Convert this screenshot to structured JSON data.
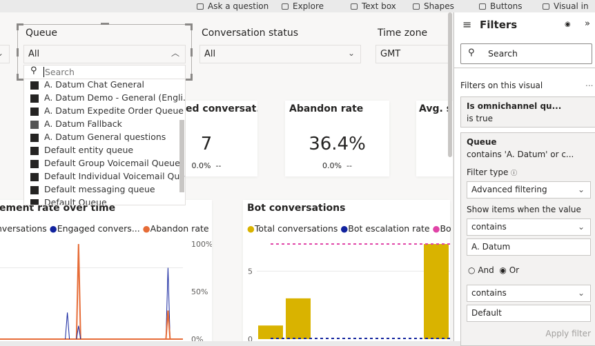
{
  "toolbar": {
    "items": [
      "Ask a question",
      "Explore",
      "Text box",
      "Shapes",
      "Buttons",
      "Visual in"
    ]
  },
  "slicers": {
    "queue": {
      "label": "Queue",
      "value": "All",
      "search_placeholder": "Search",
      "options": [
        "A. Datum Chat General",
        "A. Datum Demo - General (Engli...",
        "A. Datum Expedite Order Queue",
        "A. Datum Fallback",
        "A. Datum General questions",
        "Default entity queue",
        "Default Group Voicemail Queue",
        "Default Individual Voicemail Que...",
        "Default messaging queue",
        "Default Queue"
      ]
    },
    "status": {
      "label": "Conversation status",
      "value": "All"
    },
    "timezone": {
      "label": "Time zone",
      "value": "GMT"
    }
  },
  "cards": [
    {
      "title": "ed conversat...",
      "value": "7",
      "change": "0.0%",
      "trend": "--"
    },
    {
      "title": "Abandon rate",
      "value": "36.4%",
      "change": "0.0%",
      "trend": "--"
    },
    {
      "title": "Avg. s"
    }
  ],
  "filters": {
    "title": "Filters",
    "search_placeholder": "Search",
    "section": "Filters on this visual",
    "more": "...",
    "f1": {
      "name": "Is omnichannel qu...",
      "desc": "is true"
    },
    "f2": {
      "name": "Queue",
      "desc": "contains 'A. Datum' or c...",
      "type_label": "Filter type",
      "type_value": "Advanced filtering",
      "show_label": "Show items when the value",
      "op1": "contains",
      "val1": "A. Datum",
      "and": "And",
      "or": "Or",
      "op2": "contains",
      "val2": "Default",
      "apply": "Apply filter"
    }
  },
  "chart_data": [
    {
      "type": "line",
      "title": "ement rate over time",
      "legend": [
        "nversations",
        "Engaged convers...",
        "Abandon rate"
      ],
      "colors": [
        "#118dff",
        "#12239e",
        "#e66c37"
      ],
      "y_ticks": [
        "100%",
        "50%",
        "0%"
      ],
      "ylim": [
        0,
        100
      ],
      "spikes": [
        {
          "series": "Abandon rate",
          "x": 0.44,
          "y": 100
        },
        {
          "series": "Engaged convers...",
          "x": 0.38,
          "y": 28
        },
        {
          "series": "Engaged convers...",
          "x": 0.44,
          "y": 14
        },
        {
          "series": "Engaged convers...",
          "x": 0.92,
          "y": 75
        },
        {
          "series": "Abandon rate",
          "x": 0.92,
          "y": 30
        }
      ]
    },
    {
      "type": "bar",
      "title": "Bot conversations",
      "legend": [
        "Total conversations",
        "Bot escalation rate",
        "Bo"
      ],
      "colors": [
        "#d9b300",
        "#12239e",
        "#e044a7"
      ],
      "y_ticks": [
        "5",
        "0"
      ],
      "ylim": [
        0,
        7
      ],
      "values": [
        1,
        3,
        0,
        0,
        0,
        0,
        7
      ],
      "escalation_line": 0,
      "deflection_line": 7
    }
  ]
}
